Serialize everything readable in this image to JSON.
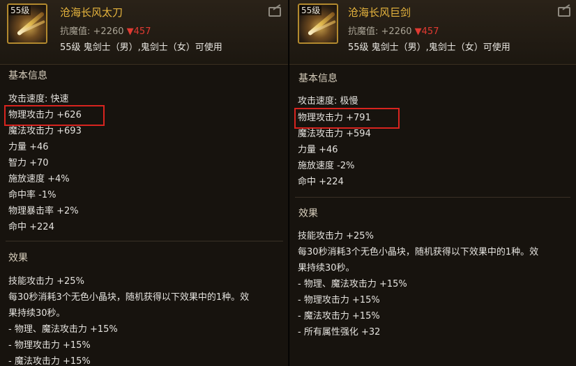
{
  "left": {
    "level_badge": "55级",
    "name": "沧海长风太刀",
    "resist_label": "抗魔值:",
    "resist_value": "+2260",
    "resist_diff": "▼457",
    "class_text": "55级 鬼剑士（男）,鬼剑士（女）可使用",
    "basic_title": "基本信息",
    "stats": [
      "攻击速度: 快速",
      "物理攻击力 +626",
      "魔法攻击力 +693",
      "力量 +46",
      "智力 +70",
      "施放速度 +4%",
      "命中率 -1%",
      "物理暴击率 +2%",
      "命中 +224"
    ],
    "effect_title": "效果",
    "effects": [
      "技能攻击力 +25%",
      "每30秒消耗3个无色小晶块，随机获得以下效果中的1种。效",
      "果持续30秒。",
      "- 物理、魔法攻击力 +15%",
      "- 物理攻击力 +15%",
      "- 魔法攻击力 +15%"
    ]
  },
  "right": {
    "level_badge": "55级",
    "name": "沧海长风巨剑",
    "resist_label": "抗魔值:",
    "resist_value": "+2260",
    "resist_diff": "▼457",
    "class_text": "55级 鬼剑士（男）,鬼剑士（女）可使用",
    "basic_title": "基本信息",
    "stats": [
      "攻击速度: 极慢",
      "物理攻击力 +791",
      "魔法攻击力 +594",
      "力量 +46",
      "施放速度 -2%",
      "命中 +224"
    ],
    "effect_title": "效果",
    "effects": [
      "技能攻击力 +25%",
      "每30秒消耗3个无色小晶块，随机获得以下效果中的1种。效",
      "果持续30秒。",
      "- 物理、魔法攻击力 +15%",
      "- 物理攻击力 +15%",
      "- 魔法攻击力 +15%",
      "- 所有属性强化 +32"
    ]
  },
  "colors": {
    "item_name": "#e7b53e",
    "resist_down": "#e03a32",
    "highlight": "#d8241f",
    "panel_bg": "#17130e"
  },
  "icons": [
    "sword-icon",
    "compare-icon"
  ]
}
